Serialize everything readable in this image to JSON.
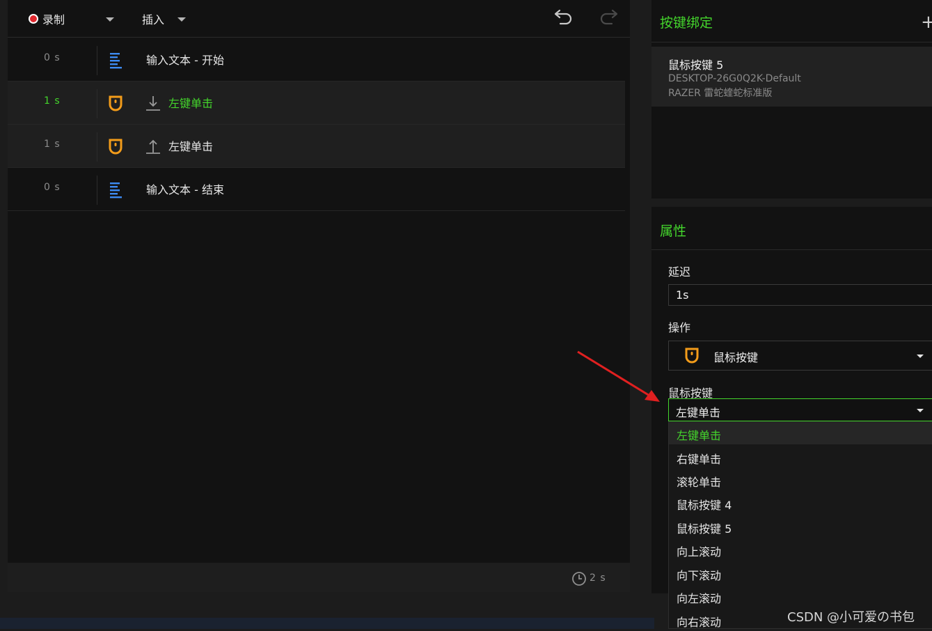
{
  "toolbar": {
    "record_label": "录制",
    "insert_label": "插入"
  },
  "macro_events": [
    {
      "time": "0 s",
      "label": "输入文本 - 开始",
      "icon": "text-lines-icon"
    },
    {
      "time": "1 s",
      "label": "左键单击",
      "icon": "mouse-icon",
      "direction": "down-arrow-icon"
    },
    {
      "time": "1 s",
      "label": "左键单击",
      "icon": "mouse-icon",
      "direction": "up-arrow-icon"
    },
    {
      "time": "0 s",
      "label": "输入文本 - 结束",
      "icon": "text-lines-icon"
    }
  ],
  "footer": {
    "total_time": "2 s"
  },
  "binding": {
    "title": "按键绑定",
    "add_symbol": "+",
    "key_name": "鼠标按键 5",
    "profile": "DESKTOP-26G0Q2K-Default",
    "device": "RAZER 雷蛇蝰蛇标准版"
  },
  "properties": {
    "title": "属性",
    "delay_label": "延迟",
    "delay_value": "1s",
    "action_label": "操作",
    "action_value": "鼠标按键",
    "mouse_button_label": "鼠标按键",
    "mouse_button_value": "左键单击",
    "options": [
      "左键单击",
      "右键单击",
      "滚轮单击",
      "鼠标按键 4",
      "鼠标按键 5",
      "向上滚动",
      "向下滚动",
      "向左滚动",
      "向右滚动"
    ]
  },
  "colors": {
    "accent": "#44d62c",
    "mouse_icon": "#f39c1a",
    "text_icon": "#3d8bf2",
    "arrow": "#e02020"
  },
  "watermark": "CSDN @小可爱の书包"
}
